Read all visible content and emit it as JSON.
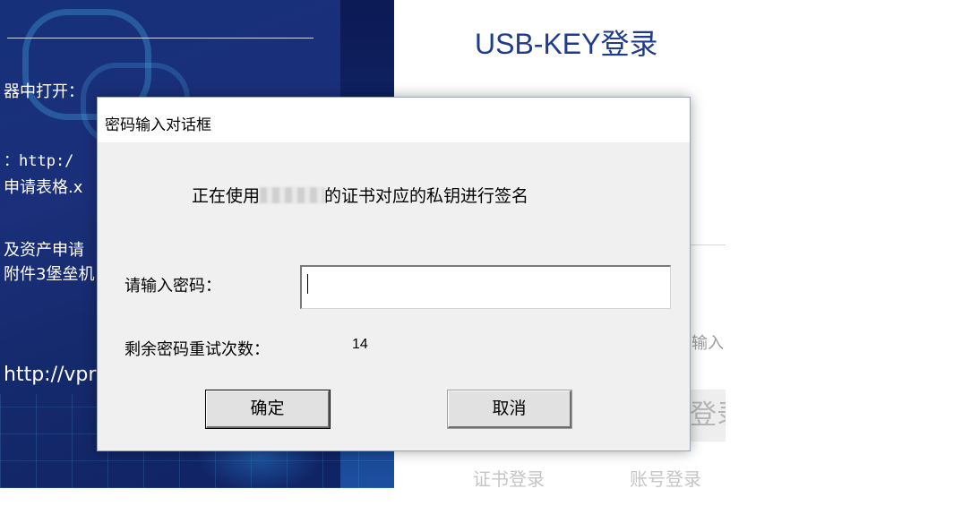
{
  "background": {
    "left_panel_lines": [
      "器中打开：",
      "：http:/",
      "申请表格.x",
      "及资产申请",
      "附件3堡垒机",
      "http://vpr"
    ]
  },
  "login": {
    "title": "USB-KEY登录",
    "input_hint": "输入",
    "button_label": "登录",
    "tabs": [
      "证书登录",
      "账号登录"
    ]
  },
  "dialog": {
    "title": "密码输入对话框",
    "message_prefix": "正在使用",
    "message_suffix": "的证书对应的私钥进行签名",
    "password_label": "请输入密码：",
    "password_value": "",
    "retry_label": "剩余密码重试次数：",
    "retry_count": "14",
    "ok_label": "确定",
    "cancel_label": "取消"
  }
}
